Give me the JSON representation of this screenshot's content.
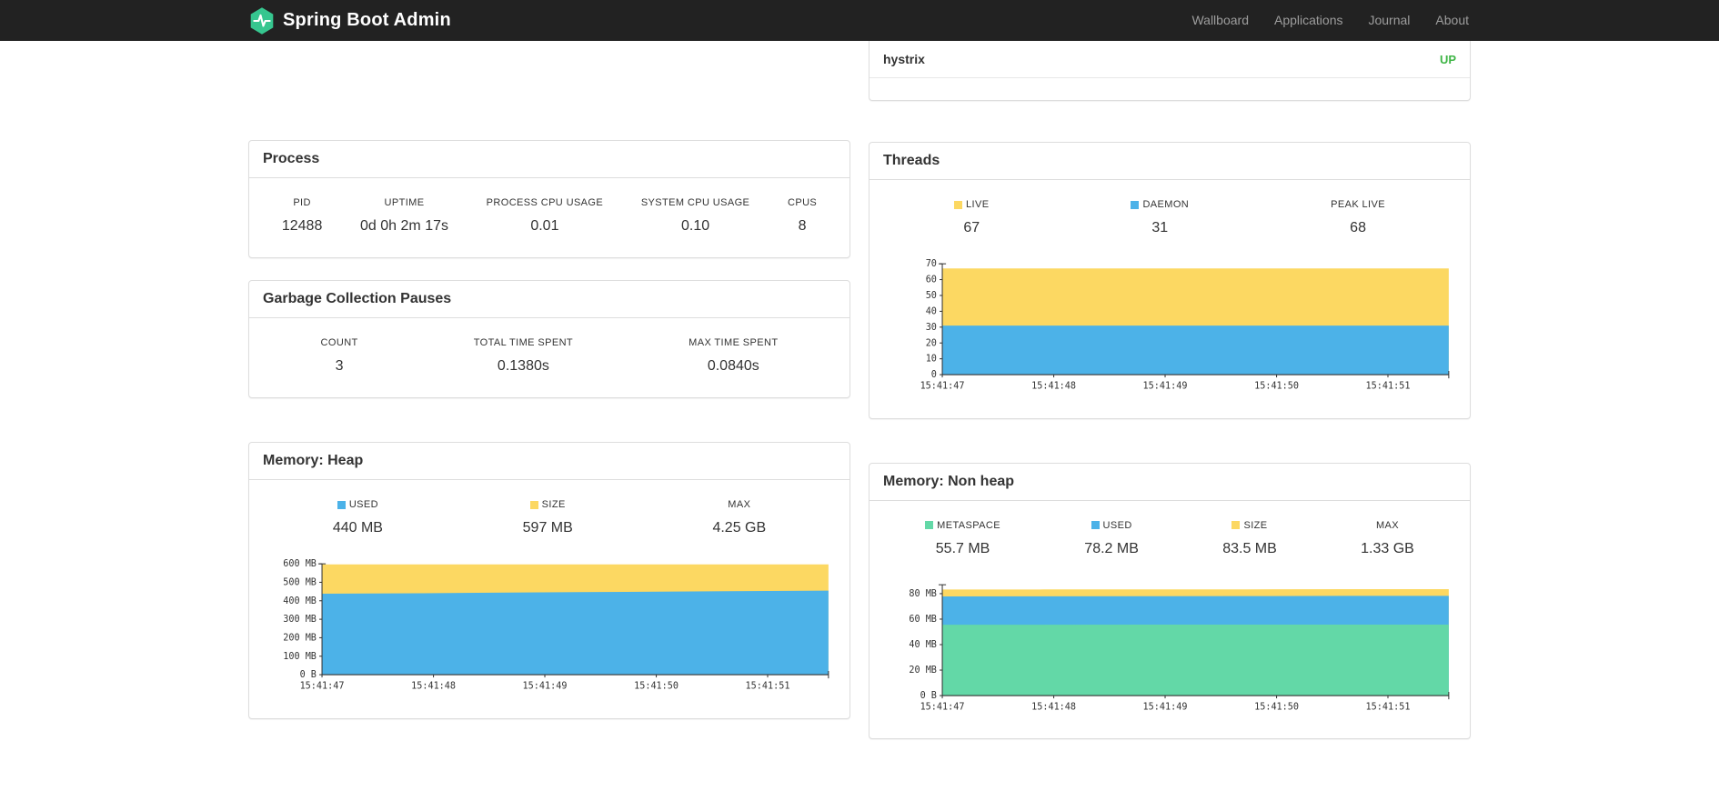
{
  "navbar": {
    "brand": "Spring Boot Admin",
    "items": [
      {
        "label": "Wallboard"
      },
      {
        "label": "Applications"
      },
      {
        "label": "Journal"
      },
      {
        "label": "About"
      }
    ]
  },
  "health_card": {
    "rows": [
      {
        "name": "hystrix",
        "status": "UP"
      }
    ],
    "up_color": "#3fb546"
  },
  "process_card": {
    "title": "Process",
    "metrics": [
      {
        "label": "PID",
        "value": "12488"
      },
      {
        "label": "UPTIME",
        "value": "0d 0h 2m 17s"
      },
      {
        "label": "PROCESS CPU USAGE",
        "value": "0.01"
      },
      {
        "label": "SYSTEM CPU USAGE",
        "value": "0.10"
      },
      {
        "label": "CPUS",
        "value": "8"
      }
    ]
  },
  "gc_card": {
    "title": "Garbage Collection Pauses",
    "metrics": [
      {
        "label": "COUNT",
        "value": "3"
      },
      {
        "label": "TOTAL TIME SPENT",
        "value": "0.1380s"
      },
      {
        "label": "MAX TIME SPENT",
        "value": "0.0840s"
      }
    ]
  },
  "threads_card": {
    "title": "Threads",
    "metrics": [
      {
        "label": "LIVE",
        "value": "67",
        "swatch": "#fcd862"
      },
      {
        "label": "DAEMON",
        "value": "31",
        "swatch": "#4cb2e8"
      },
      {
        "label": "PEAK LIVE",
        "value": "68"
      }
    ]
  },
  "heap_card": {
    "title": "Memory: Heap",
    "metrics": [
      {
        "label": "USED",
        "value": "440 MB",
        "swatch": "#4cb2e8"
      },
      {
        "label": "SIZE",
        "value": "597 MB",
        "swatch": "#fcd862"
      },
      {
        "label": "MAX",
        "value": "4.25 GB"
      }
    ]
  },
  "nonheap_card": {
    "title": "Memory: Non heap",
    "metrics": [
      {
        "label": "METASPACE",
        "value": "55.7 MB",
        "swatch": "#63d8a7"
      },
      {
        "label": "USED",
        "value": "78.2 MB",
        "swatch": "#4cb2e8"
      },
      {
        "label": "SIZE",
        "value": "83.5 MB",
        "swatch": "#fcd862"
      },
      {
        "label": "MAX",
        "value": "1.33 GB"
      }
    ]
  },
  "colors": {
    "navbar_bg": "#222222",
    "brand_green": "#36c68f",
    "chart_blue": "#4cb2e8",
    "chart_yellow": "#fcd862",
    "chart_green": "#63d8a7",
    "status_up": "#3fb546"
  },
  "chart_data": [
    {
      "id": "threads",
      "type": "area",
      "title": "Threads",
      "y_max": 70,
      "x_ticks": [
        "15:41:47",
        "15:41:48",
        "15:41:49",
        "15:41:50",
        "15:41:51"
      ],
      "y_ticks": [
        {
          "value": 0,
          "label": "0"
        },
        {
          "value": 10,
          "label": "10"
        },
        {
          "value": 20,
          "label": "20"
        },
        {
          "value": 30,
          "label": "30"
        },
        {
          "value": 40,
          "label": "40"
        },
        {
          "value": 50,
          "label": "50"
        },
        {
          "value": 60,
          "label": "60"
        },
        {
          "value": 70,
          "label": "70"
        }
      ],
      "series": [
        {
          "name": "LIVE",
          "color": "#fcd862",
          "values": [
            67,
            67,
            67,
            67,
            67,
            67
          ]
        },
        {
          "name": "DAEMON",
          "color": "#4cb2e8",
          "values": [
            31,
            31,
            31,
            31,
            31,
            31
          ]
        }
      ]
    },
    {
      "id": "heap",
      "type": "area",
      "title": "Memory: Heap",
      "y_max": 600,
      "x_ticks": [
        "15:41:47",
        "15:41:48",
        "15:41:49",
        "15:41:50",
        "15:41:51"
      ],
      "y_ticks": [
        {
          "value": 0,
          "label": "0 B"
        },
        {
          "value": 100,
          "label": "100 MB"
        },
        {
          "value": 200,
          "label": "200 MB"
        },
        {
          "value": 300,
          "label": "300 MB"
        },
        {
          "value": 400,
          "label": "400 MB"
        },
        {
          "value": 500,
          "label": "500 MB"
        },
        {
          "value": 600,
          "label": "600 MB"
        }
      ],
      "series": [
        {
          "name": "SIZE",
          "color": "#fcd862",
          "values": [
            597,
            597,
            597,
            597,
            597,
            597
          ]
        },
        {
          "name": "USED",
          "color": "#4cb2e8",
          "values": [
            438,
            441,
            445,
            448,
            452,
            455
          ]
        }
      ]
    },
    {
      "id": "nonheap",
      "type": "area",
      "title": "Memory: Non heap",
      "y_max": 87,
      "x_ticks": [
        "15:41:47",
        "15:41:48",
        "15:41:49",
        "15:41:50",
        "15:41:51"
      ],
      "y_ticks": [
        {
          "value": 0,
          "label": "0 B"
        },
        {
          "value": 20,
          "label": "20 MB"
        },
        {
          "value": 40,
          "label": "40 MB"
        },
        {
          "value": 60,
          "label": "60 MB"
        },
        {
          "value": 80,
          "label": "80 MB"
        }
      ],
      "series": [
        {
          "name": "SIZE",
          "color": "#fcd862",
          "values": [
            83.2,
            83.3,
            83.4,
            83.4,
            83.5,
            83.5
          ]
        },
        {
          "name": "USED",
          "color": "#4cb2e8",
          "values": [
            77.8,
            77.9,
            78.0,
            78.1,
            78.2,
            78.2
          ]
        },
        {
          "name": "METASPACE",
          "color": "#63d8a7",
          "values": [
            55.6,
            55.6,
            55.7,
            55.7,
            55.7,
            55.7
          ]
        }
      ]
    }
  ]
}
